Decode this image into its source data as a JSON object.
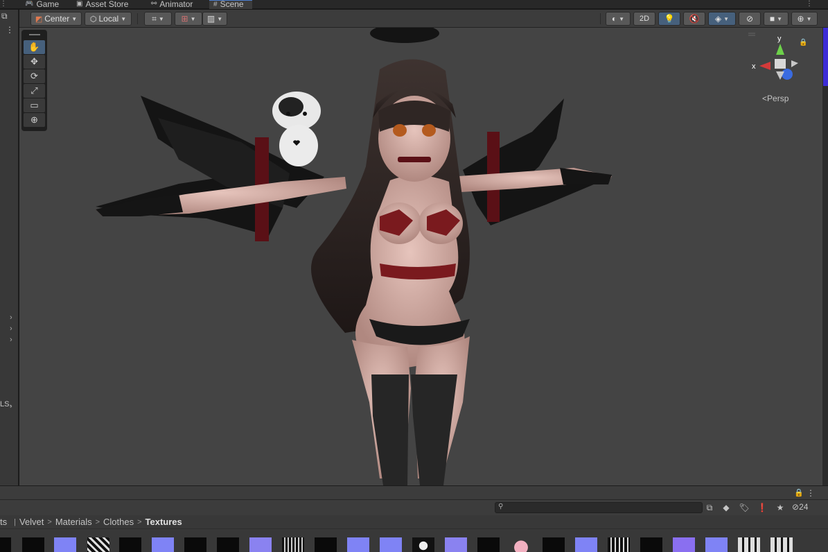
{
  "tabs": [
    {
      "label": "Game",
      "icon": "gamepad-icon"
    },
    {
      "label": "Asset Store",
      "icon": "store-icon"
    },
    {
      "label": "Animator",
      "icon": "animator-icon"
    },
    {
      "label": "Scene",
      "icon": "grid-hash-icon",
      "active": true
    }
  ],
  "toolbar": {
    "pivot_label": "Center",
    "space_label": "Local",
    "mode_2d_label": "2D"
  },
  "tools": [
    "hand-tool",
    "move-tool",
    "rotate-tool",
    "scale-tool",
    "rect-tool",
    "transform-tool"
  ],
  "gizmo": {
    "y_label": "y",
    "x_label": "x",
    "projection_label": "Persp"
  },
  "left_panel": {
    "truncated_text": "LS."
  },
  "project": {
    "search_placeholder": "",
    "hidden_count": "24",
    "breadcrumb": {
      "lead": "ts",
      "items": [
        "Velvet",
        "Materials",
        "Clothes"
      ],
      "current": "Textures"
    }
  },
  "colors": {
    "active_tab_accent": "#4c7fd0",
    "toolbar_active": "#46607c",
    "viewport_bg": "#444444",
    "gizmo_y": "#6dd14a",
    "gizmo_x": "#d43a3a",
    "gizmo_z": "#3a6be0"
  }
}
